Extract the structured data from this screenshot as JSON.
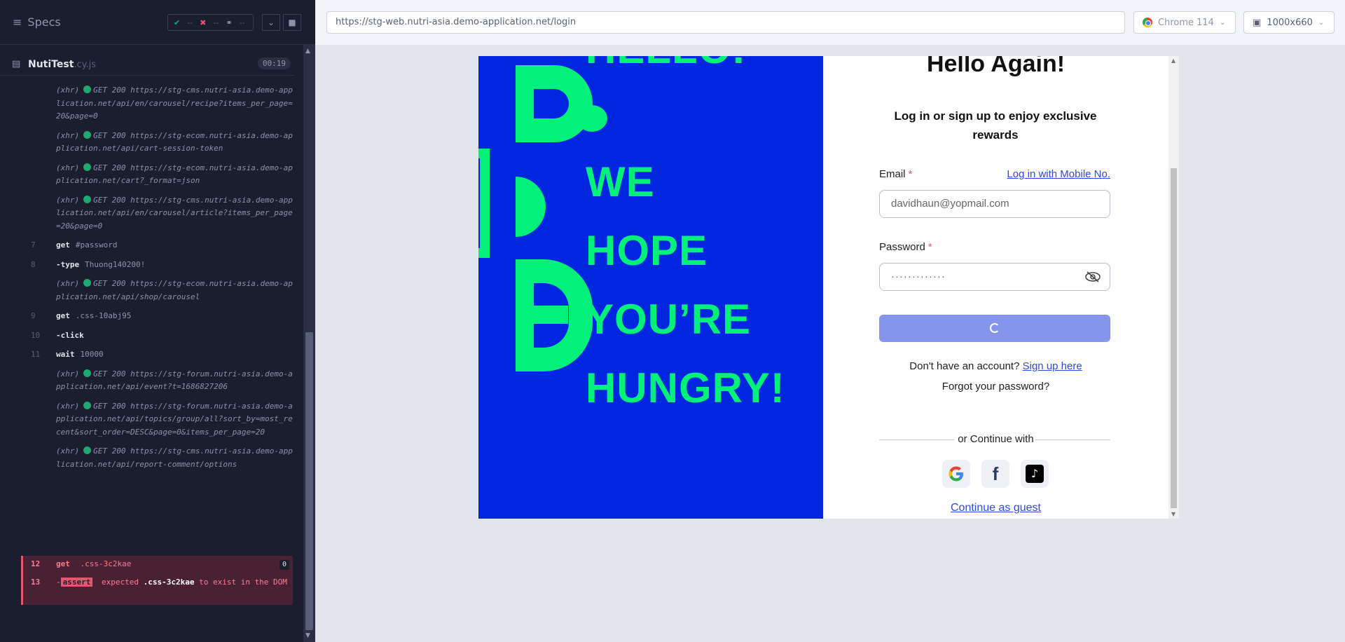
{
  "specs_bar": {
    "title": "Specs",
    "passed": "--",
    "failed": "--",
    "pending": "--"
  },
  "spec_file": {
    "name": "NutiTest",
    "ext": ".cy.js",
    "timer": "00:19"
  },
  "log": [
    {
      "num": "",
      "type": "xhr",
      "prefix": "(xhr)",
      "text": "GET 200 https://stg-cms.nutri-asia.demo-application.net/api/en/carousel/recipe?items_per_page=20&page=0"
    },
    {
      "num": "",
      "type": "xhr",
      "prefix": "(xhr)",
      "text": "GET 200 https://stg-ecom.nutri-asia.demo-application.net/api/cart-session-token"
    },
    {
      "num": "",
      "type": "xhr",
      "prefix": "(xhr)",
      "text": "GET 200 https://stg-ecom.nutri-asia.demo-application.net/cart?_format=json"
    },
    {
      "num": "",
      "type": "xhr",
      "prefix": "(xhr)",
      "text": "GET 200 https://stg-cms.nutri-asia.demo-application.net/api/en/carousel/article?items_per_page=20&page=0"
    },
    {
      "num": "7",
      "type": "cmd",
      "cmd": "get",
      "arg": "#password"
    },
    {
      "num": "8",
      "type": "cmd",
      "cmd": "-type",
      "arg": "Thuong140200!"
    },
    {
      "num": "",
      "type": "xhr",
      "prefix": "(xhr)",
      "text": "GET 200 https://stg-ecom.nutri-asia.demo-application.net/api/shop/carousel"
    },
    {
      "num": "9",
      "type": "cmd",
      "cmd": "get",
      "arg": ".css-10abj95"
    },
    {
      "num": "10",
      "type": "cmd",
      "cmd": "-click",
      "arg": ""
    },
    {
      "num": "11",
      "type": "cmd",
      "cmd": "wait",
      "arg": "10000"
    },
    {
      "num": "",
      "type": "xhr",
      "prefix": "(xhr)",
      "text": "GET 200 https://stg-forum.nutri-asia.demo-application.net/api/event?t=1686827206"
    },
    {
      "num": "",
      "type": "xhr",
      "prefix": "(xhr)",
      "text": "GET 200 https://stg-forum.nutri-asia.demo-application.net/api/topics/group/all?sort_by=most_recent&sort_order=DESC&page=0&items_per_page=20"
    },
    {
      "num": "",
      "type": "xhr",
      "prefix": "(xhr)",
      "text": "GET 200 https://stg-cms.nutri-asia.demo-application.net/api/report-comment/options"
    }
  ],
  "failed_cmds": {
    "row12": {
      "num": "12",
      "cmd": "get",
      "arg": ".css-3c2kae",
      "badge": "0"
    },
    "row13": {
      "num": "13",
      "dash": "-",
      "tag": "assert",
      "pre": "expected",
      "selector": ".css-3c2kae",
      "post": "to exist in the DOM"
    }
  },
  "topbar": {
    "url": "https://stg-web.nutri-asia.demo-application.net/login",
    "browser": "Chrome 114",
    "viewport": "1000x660"
  },
  "hero": {
    "top_word": "HELLO!",
    "words": [
      "WE",
      "HOPE",
      "YOU’RE",
      "HUNGRY!"
    ]
  },
  "login": {
    "title": "Hello Again!",
    "subtitle": "Log in or sign up to enjoy exclusive rewards",
    "email_label": "Email",
    "required_mark": "*",
    "mobile_link": "Log in with Mobile No.",
    "email_value": "davidhaun@yopmail.com",
    "password_label": "Password",
    "password_value": "·············",
    "no_account": "Don't have an account?",
    "sign_up": "Sign up here",
    "forgot": "Forgot your password?",
    "continue_with": "or Continue with",
    "guest": "Continue as guest"
  },
  "colors": {
    "hero_bg": "#0026e0",
    "hero_accent": "#00f07a",
    "link": "#2d49e6",
    "submit_loading": "#8595ec",
    "cypress_pass": "#1fa971",
    "cypress_fail": "#e45770"
  }
}
